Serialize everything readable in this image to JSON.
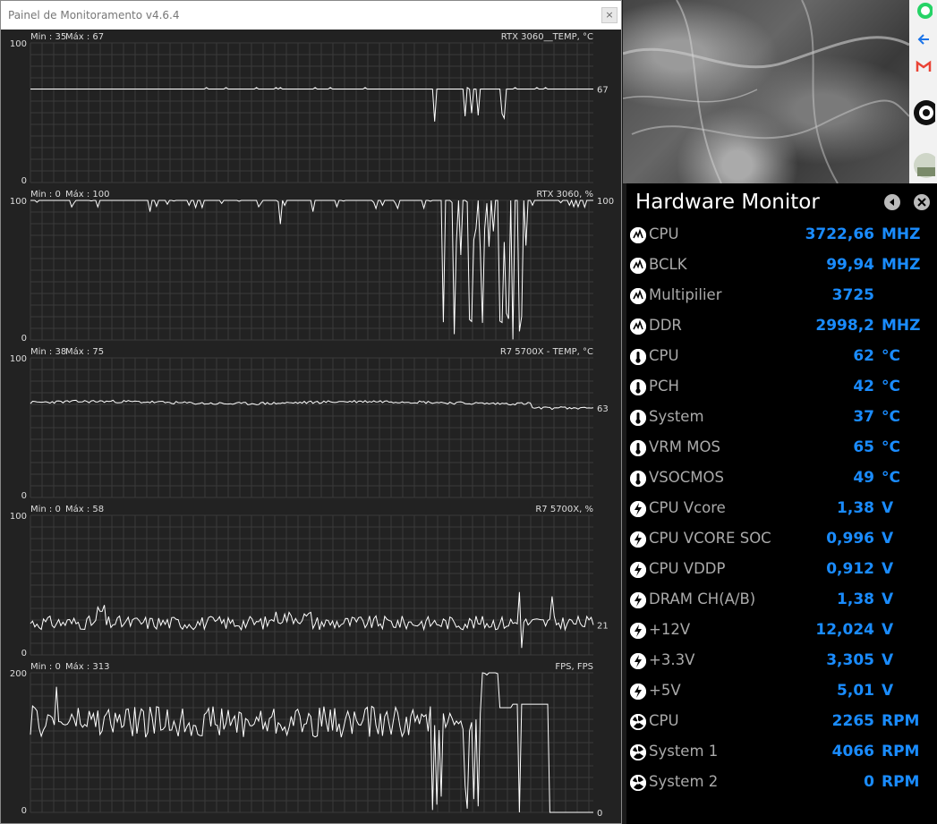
{
  "window": {
    "title": "Painel de Monitoramento v4.6.4",
    "close": "×"
  },
  "graphs": [
    {
      "name": "RTX 3060__TEMP, °C",
      "min_label": "Min : 35",
      "max_label": "Máx : 67",
      "y_top": "100",
      "y_bottom": "0",
      "current": "67"
    },
    {
      "name": "RTX 3060, %",
      "min_label": "Min : 0",
      "max_label": "Máx : 100",
      "y_top": "100",
      "y_bottom": "0",
      "current": "100"
    },
    {
      "name": "R7 5700X - TEMP, °C",
      "min_label": "Min : 38",
      "max_label": "Máx : 75",
      "y_top": "100",
      "y_bottom": "0",
      "current": "63"
    },
    {
      "name": "R7 5700X, %",
      "min_label": "Min : 0",
      "max_label": "Máx : 58",
      "y_top": "100",
      "y_bottom": "0",
      "current": "21"
    },
    {
      "name": "FPS, FPS",
      "min_label": "Min : 0",
      "max_label": "Máx : 313",
      "y_top": "200",
      "y_bottom": "0",
      "current": "0"
    }
  ],
  "hardware_monitor": {
    "title": "Hardware Monitor",
    "rows": [
      {
        "icon": "cpu-chip-icon",
        "label": "CPU",
        "value": "3722,66",
        "unit": "MHZ"
      },
      {
        "icon": "cpu-chip-icon",
        "label": "BCLK",
        "value": "99,94",
        "unit": "MHZ"
      },
      {
        "icon": "cpu-chip-icon",
        "label": "Multipilier",
        "value": "3725",
        "unit": ""
      },
      {
        "icon": "cpu-chip-icon",
        "label": "DDR",
        "value": "2998,2",
        "unit": "MHZ"
      },
      {
        "icon": "thermometer-icon",
        "label": "CPU",
        "value": "62",
        "unit": "°C"
      },
      {
        "icon": "thermometer-icon",
        "label": "PCH",
        "value": "42",
        "unit": "°C"
      },
      {
        "icon": "thermometer-icon",
        "label": "System",
        "value": "37",
        "unit": "°C"
      },
      {
        "icon": "thermometer-icon",
        "label": "VRM MOS",
        "value": "65",
        "unit": "°C"
      },
      {
        "icon": "thermometer-icon",
        "label": "VSOCMOS",
        "value": "49",
        "unit": "°C"
      },
      {
        "icon": "lightning-icon",
        "label": "CPU Vcore",
        "value": "1,38",
        "unit": "V"
      },
      {
        "icon": "lightning-icon",
        "label": "CPU VCORE SOC",
        "value": "0,996",
        "unit": "V"
      },
      {
        "icon": "lightning-icon",
        "label": "CPU VDDP",
        "value": "0,912",
        "unit": "V"
      },
      {
        "icon": "lightning-icon",
        "label": "DRAM CH(A/B)",
        "value": "1,38",
        "unit": "V"
      },
      {
        "icon": "lightning-icon",
        "label": "+12V",
        "value": "12,024",
        "unit": "V"
      },
      {
        "icon": "lightning-icon",
        "label": "+3.3V",
        "value": "3,305",
        "unit": "V"
      },
      {
        "icon": "lightning-icon",
        "label": "+5V",
        "value": "5,01",
        "unit": "V"
      },
      {
        "icon": "fan-icon",
        "label": "CPU",
        "value": "2265",
        "unit": "RPM"
      },
      {
        "icon": "fan-icon",
        "label": "System 1",
        "value": "4066",
        "unit": "RPM"
      },
      {
        "icon": "fan-icon",
        "label": "System 2",
        "value": "0",
        "unit": "RPM"
      }
    ]
  },
  "colors": {
    "value_blue": "#1a8cff",
    "label_grey": "#aaaaaa",
    "graph_line": "#ffffff",
    "graph_grid": "#3a3a3a"
  }
}
